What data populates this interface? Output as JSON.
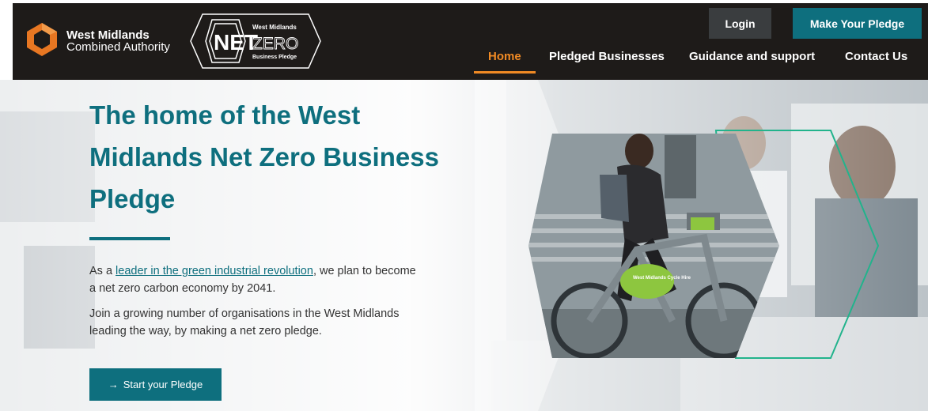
{
  "header": {
    "wmca_name_line1": "West Midlands",
    "wmca_name_line2": "Combined Authority",
    "netzero_logo": {
      "top": "West Midlands",
      "net": "NET",
      "zero": "ZERO",
      "sub": "Business Pledge"
    },
    "login_label": "Login",
    "pledge_label": "Make Your Pledge",
    "nav": [
      {
        "label": "Home",
        "active": true
      },
      {
        "label": "Pledged Businesses",
        "active": false
      },
      {
        "label": "Guidance and support",
        "active": false
      },
      {
        "label": "Contact Us",
        "active": false
      }
    ]
  },
  "hero": {
    "title": "The home of the West Midlands Net Zero Business Pledge",
    "p1_before": "As a ",
    "p1_link": "leader in the green industrial revolution",
    "p1_after": ", we plan to become a net zero carbon economy by 2041.",
    "p2": "Join a growing number of organisations in the West Midlands leading the way, by making a net zero pledge.",
    "cta_arrow": "→",
    "cta_label": "Start your Pledge",
    "bike_sign": "West Midlands Cycle Hire"
  },
  "colors": {
    "header_bg": "#1e1b19",
    "teal": "#0e6f7e",
    "nav_active": "#f08a24",
    "login_bg": "#3a3d3f",
    "logo_orange": "#e87722",
    "bike_green": "#8dc63f",
    "accent_green": "#22b38c"
  }
}
